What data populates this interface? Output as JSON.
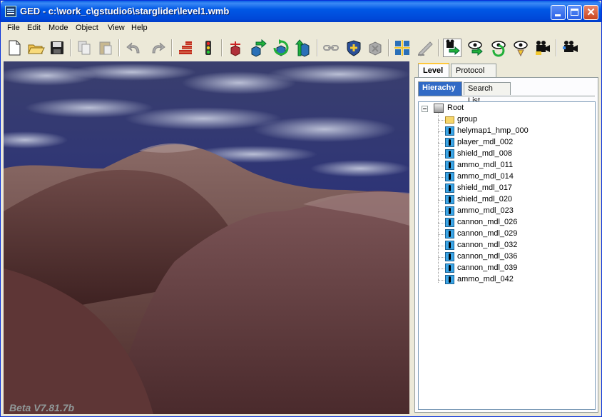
{
  "window": {
    "title": "GED - c:\\work_c\\gstudio6\\starglider\\level1.wmb",
    "close_glyph": "✕"
  },
  "menu": [
    "File",
    "Edit",
    "Mode",
    "Object",
    "View",
    "Help"
  ],
  "toolbar": {
    "buttons": [
      "new-file-icon",
      "open-folder-icon",
      "save-disk-icon",
      "copy-icon",
      "paste-icon",
      "undo-icon",
      "redo-icon",
      "wall-icon",
      "traffic-light-icon",
      "add-entity-icon",
      "move-object-icon",
      "rotate-object-icon",
      "scale-object-icon",
      "link-icon",
      "add-shield-icon",
      "block-icon",
      "split-icon",
      "hand-tool-icon",
      "camera-move-icon",
      "eye-move-icon",
      "eye-rotate-icon",
      "eye-walk-icon",
      "camera-icon",
      "render-camera-icon"
    ]
  },
  "viewport": {
    "watermark": "Beta V7.81.7b"
  },
  "panel": {
    "tabs": [
      "Level",
      "Protocol"
    ],
    "active_tab": "Level",
    "subtabs": [
      "Hierachy",
      "Search List"
    ],
    "active_subtab": "Hierachy",
    "tree": {
      "root": "Root",
      "children": [
        {
          "label": "group",
          "icon": "folder-icon"
        },
        {
          "label": "helymap1_hmp_000",
          "icon": "model-icon"
        },
        {
          "label": "player_mdl_002",
          "icon": "model-icon"
        },
        {
          "label": "shield_mdl_008",
          "icon": "model-icon"
        },
        {
          "label": "ammo_mdl_011",
          "icon": "model-icon"
        },
        {
          "label": "ammo_mdl_014",
          "icon": "model-icon"
        },
        {
          "label": "shield_mdl_017",
          "icon": "model-icon"
        },
        {
          "label": "shield_mdl_020",
          "icon": "model-icon"
        },
        {
          "label": "ammo_mdl_023",
          "icon": "model-icon"
        },
        {
          "label": "cannon_mdl_026",
          "icon": "model-icon"
        },
        {
          "label": "cannon_mdl_029",
          "icon": "model-icon"
        },
        {
          "label": "cannon_mdl_032",
          "icon": "model-icon"
        },
        {
          "label": "cannon_mdl_036",
          "icon": "model-icon"
        },
        {
          "label": "cannon_mdl_039",
          "icon": "model-icon"
        },
        {
          "label": "ammo_mdl_042",
          "icon": "model-icon"
        }
      ]
    }
  },
  "colors": {
    "titlebar": "#0058E6",
    "selection": "#316AC5",
    "sky": "#2a2f7a",
    "terrain": "#6a3a38"
  }
}
